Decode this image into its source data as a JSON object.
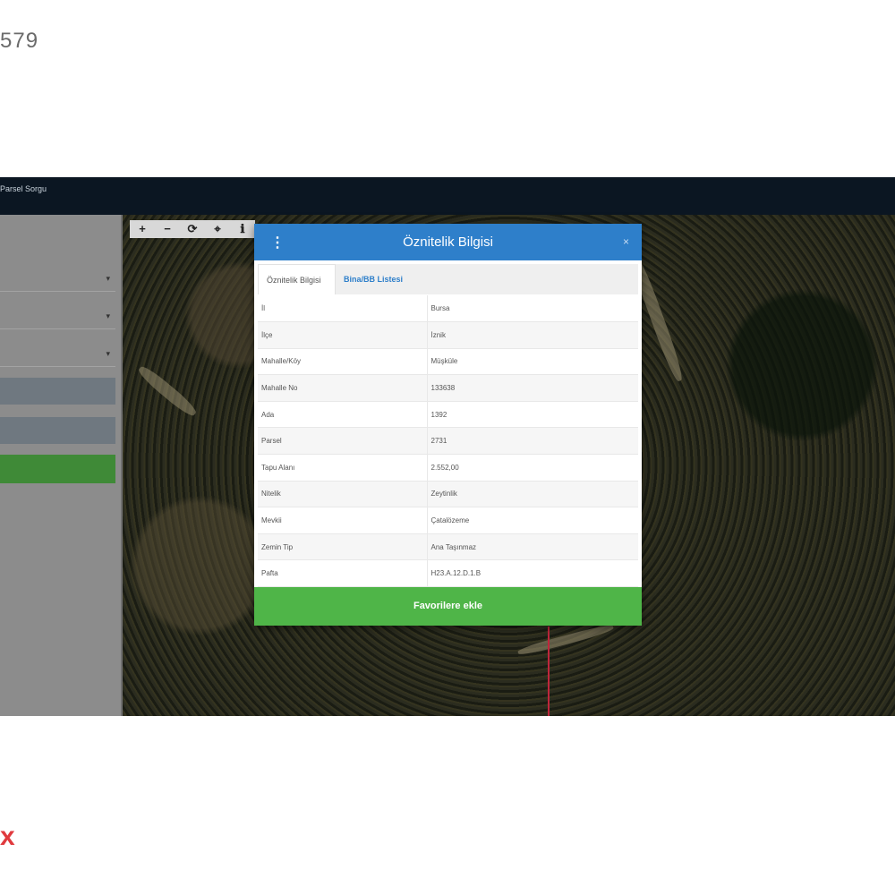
{
  "listing": {
    "number_fragment": "579"
  },
  "brand": {
    "mark": "x"
  },
  "app": {
    "title": "Parsel Sorgu",
    "sidebar": {
      "heading": "",
      "fields": [
        "",
        "",
        ""
      ],
      "buttons": [
        "",
        ""
      ],
      "go_label": "",
      "footer": ""
    },
    "map_tools": [
      "+",
      "−",
      "⟳",
      "⌖",
      "ℹ"
    ]
  },
  "modal": {
    "menu_icon": "⋮",
    "title": "Öznitelik Bilgisi",
    "close_icon": "×",
    "tabs": [
      "Öznitelik Bilgisi",
      "Bina/BB Listesi"
    ],
    "rows": [
      {
        "key": "İl",
        "value": "Bursa"
      },
      {
        "key": "İlçe",
        "value": "İznik"
      },
      {
        "key": "Mahalle/Köy",
        "value": "Müşküle"
      },
      {
        "key": "Mahalle No",
        "value": "133638"
      },
      {
        "key": "Ada",
        "value": "1392"
      },
      {
        "key": "Parsel",
        "value": "2731"
      },
      {
        "key": "Tapu Alanı",
        "value": "2.552,00"
      },
      {
        "key": "Nitelik",
        "value": "Zeytinlik"
      },
      {
        "key": "Mevkii",
        "value": "Çatalözeme"
      },
      {
        "key": "Zemin Tip",
        "value": "Ana Taşınmaz"
      },
      {
        "key": "Pafta",
        "value": "H23.A.12.D.1.B"
      }
    ],
    "favorite_button": "Favorilere ekle"
  },
  "colors": {
    "header_blue": "#2e7fca",
    "favorite_green": "#4fb548",
    "sidebar_green": "#3f8a37",
    "brand_red": "#e03a3e"
  }
}
